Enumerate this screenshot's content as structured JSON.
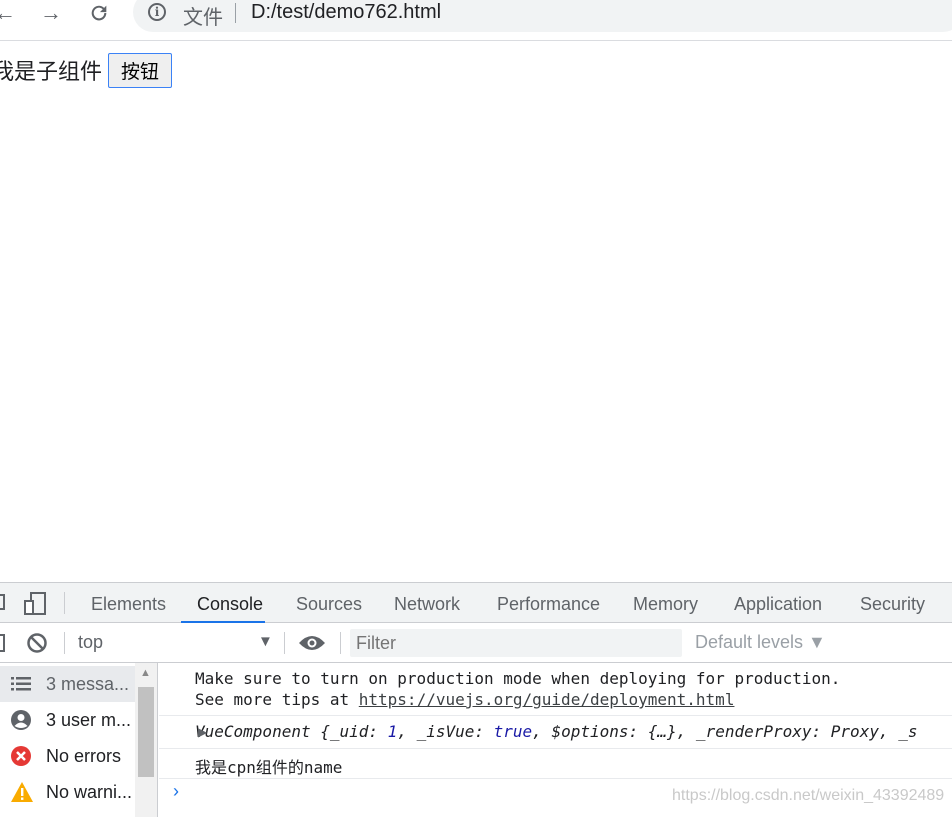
{
  "browser": {
    "back": "←",
    "forward": "→",
    "reload": "C",
    "file_label": "文件",
    "url": "D:/test/demo762.html"
  },
  "page": {
    "child_text": "我是子组件",
    "button_label": "按钮"
  },
  "devtools": {
    "tabs": [
      "Elements",
      "Console",
      "Sources",
      "Network",
      "Performance",
      "Memory",
      "Application",
      "Security"
    ],
    "active_tab": "Console",
    "context": "top",
    "filter_placeholder": "Filter",
    "levels": "Default levels ▼",
    "sidebar": {
      "items": [
        {
          "label": "3 messa...",
          "icon": "list-icon"
        },
        {
          "label": "3 user m...",
          "icon": "user-icon"
        },
        {
          "label": "No errors",
          "icon": "error-icon"
        },
        {
          "label": "No warni...",
          "icon": "warning-icon"
        }
      ]
    },
    "console": {
      "line_production": "Make sure to turn on production mode when deploying for production.",
      "line_tips_prefix": "See more tips at ",
      "line_tips_link": "https://vuejs.org/guide/deployment.html",
      "vc_name": "VueComponent ",
      "vc_open": "{_uid: ",
      "vc_uid": "1",
      "vc_isvue_key": ", _isVue: ",
      "vc_isvue": "true",
      "vc_rest": ", $options: {…}, _renderProxy: Proxy, _s",
      "line_name": "我是cpn组件的name"
    }
  },
  "watermark": "https://blog.csdn.net/weixin_43392489"
}
